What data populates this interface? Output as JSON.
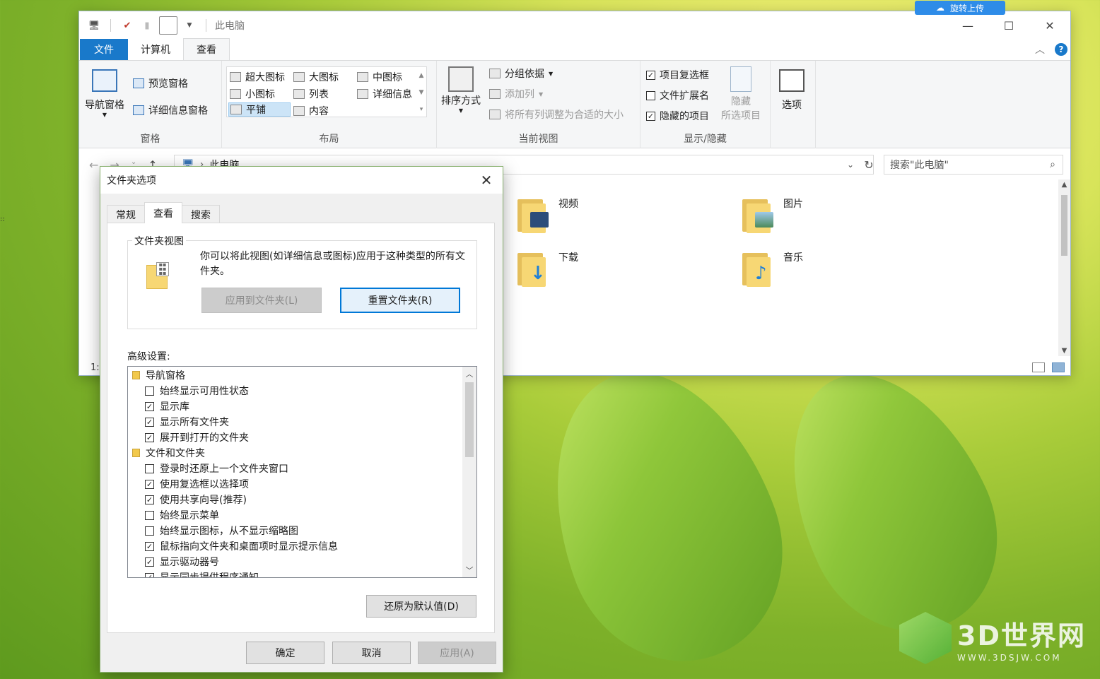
{
  "window": {
    "title": "此电脑",
    "cloud_button": "旋转上传"
  },
  "ribbon": {
    "tabs": [
      "文件",
      "计算机",
      "查看"
    ],
    "panes_group": {
      "label": "窗格",
      "nav_pane": "导航窗格",
      "preview_pane": "预览窗格",
      "details_pane": "详细信息窗格"
    },
    "layout_group": {
      "label": "布局",
      "items": [
        "超大图标",
        "大图标",
        "中图标",
        "小图标",
        "列表",
        "详细信息",
        "平铺",
        "内容"
      ],
      "selected": "平铺"
    },
    "current_view_group": {
      "label": "当前视图",
      "sort_by": "排序方式",
      "group_by": "分组依据",
      "add_column": "添加列",
      "fit_columns": "将所有列调整为合适的大小"
    },
    "show_hide_group": {
      "label": "显示/隐藏",
      "item_checkboxes": "项目复选框",
      "file_extensions": "文件扩展名",
      "hidden_items": "隐藏的项目",
      "hide_selected_line1": "隐藏",
      "hide_selected_line2": "所选项目",
      "item_checkboxes_checked": true,
      "file_extensions_checked": false,
      "hidden_items_checked": true
    },
    "options": "选项"
  },
  "address": {
    "path": "此电脑",
    "search_placeholder": "搜索\"此电脑\""
  },
  "content": {
    "folders": [
      {
        "name": "视频"
      },
      {
        "name": "图片"
      },
      {
        "name": "下载"
      },
      {
        "name": "音乐"
      }
    ],
    "status_count": "1:"
  },
  "dialog": {
    "title": "文件夹选项",
    "tabs": [
      "常规",
      "查看",
      "搜索"
    ],
    "active_tab": "查看",
    "folder_views": {
      "legend": "文件夹视图",
      "description": "你可以将此视图(如详细信息或图标)应用于这种类型的所有文件夹。",
      "apply_button": "应用到文件夹(L)",
      "reset_button": "重置文件夹(R)"
    },
    "advanced_label": "高级设置:",
    "tree": [
      {
        "type": "cat",
        "label": "导航窗格"
      },
      {
        "type": "opt",
        "label": "始终显示可用性状态",
        "checked": false
      },
      {
        "type": "opt",
        "label": "显示库",
        "checked": true
      },
      {
        "type": "opt",
        "label": "显示所有文件夹",
        "checked": true
      },
      {
        "type": "opt",
        "label": "展开到打开的文件夹",
        "checked": true
      },
      {
        "type": "cat",
        "label": "文件和文件夹"
      },
      {
        "type": "opt",
        "label": "登录时还原上一个文件夹窗口",
        "checked": false
      },
      {
        "type": "opt",
        "label": "使用复选框以选择项",
        "checked": true
      },
      {
        "type": "opt",
        "label": "使用共享向导(推荐)",
        "checked": true
      },
      {
        "type": "opt",
        "label": "始终显示菜单",
        "checked": false
      },
      {
        "type": "opt",
        "label": "始终显示图标，从不显示缩略图",
        "checked": false
      },
      {
        "type": "opt",
        "label": "鼠标指向文件夹和桌面项时显示提示信息",
        "checked": true
      },
      {
        "type": "opt",
        "label": "显示驱动器号",
        "checked": true
      },
      {
        "type": "opt",
        "label": "显示同步提供程序通知",
        "checked": true
      }
    ],
    "restore_defaults": "还原为默认值(D)",
    "ok": "确定",
    "cancel": "取消",
    "apply": "应用(A)"
  },
  "watermark": {
    "brand": "3D世界网",
    "url": "WWW.3DSJW.COM"
  },
  "colors": {
    "accent": "#1979ca",
    "focus_border": "#0078d7",
    "folder_yellow": "#f7d774"
  }
}
